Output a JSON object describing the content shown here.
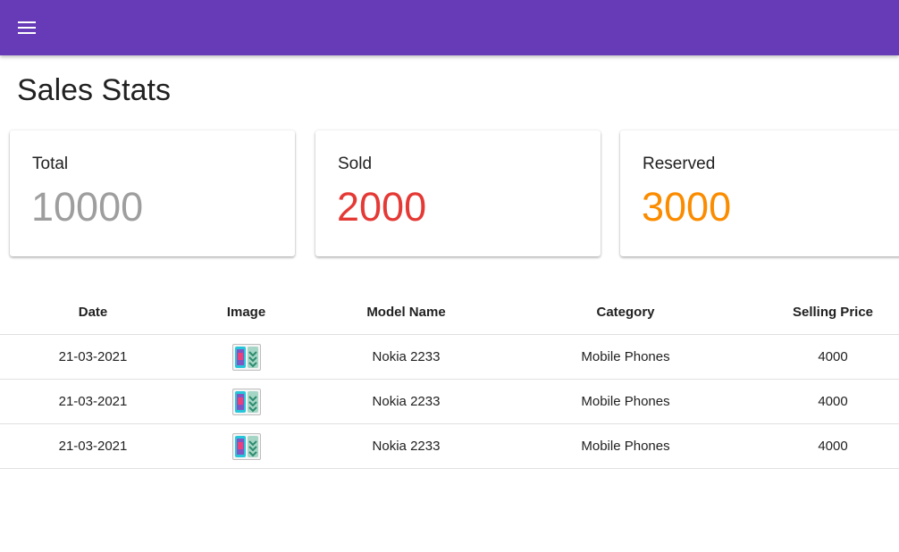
{
  "app_bar": {
    "color": "#673ab7",
    "menu_icon": "menu-icon"
  },
  "page": {
    "title": "Sales Stats"
  },
  "stats": [
    {
      "label": "Total",
      "value": "10000",
      "color": "#9e9e9e"
    },
    {
      "label": "Sold",
      "value": "2000",
      "color": "#e53935"
    },
    {
      "label": "Reserved",
      "value": "3000",
      "color": "#fb8c00"
    }
  ],
  "table": {
    "headers": [
      "Date",
      "Image",
      "Model Name",
      "Category",
      "Selling Price"
    ],
    "rows": [
      {
        "date": "21-03-2021",
        "image_icon": "phone-thumbnail-icon",
        "model": "Nokia 2233",
        "category": "Mobile Phones",
        "price": "4000"
      },
      {
        "date": "21-03-2021",
        "image_icon": "phone-thumbnail-icon",
        "model": "Nokia 2233",
        "category": "Mobile Phones",
        "price": "4000"
      },
      {
        "date": "21-03-2021",
        "image_icon": "phone-thumbnail-icon",
        "model": "Nokia 2233",
        "category": "Mobile Phones",
        "price": "4000"
      }
    ]
  }
}
